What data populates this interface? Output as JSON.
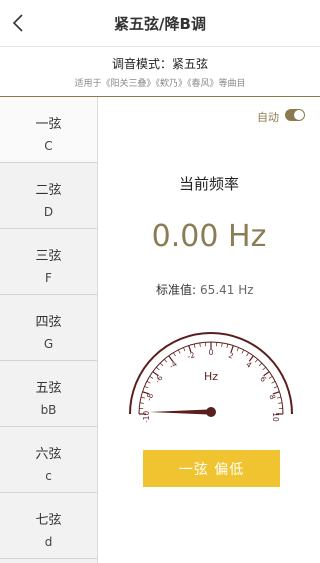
{
  "header": {
    "title": "紧五弦/降B调",
    "back_icon": "chevron-left-icon"
  },
  "mode": {
    "label": "调音模式：紧五弦",
    "songs": "适用于《阳关三叠》《欸乃》《春风》等曲目"
  },
  "strings": [
    {
      "name": "一弦",
      "note": "C"
    },
    {
      "name": "二弦",
      "note": "D"
    },
    {
      "name": "三弦",
      "note": "F"
    },
    {
      "name": "四弦",
      "note": "G"
    },
    {
      "name": "五弦",
      "note": "bB"
    },
    {
      "name": "六弦",
      "note": "c"
    },
    {
      "name": "七弦",
      "note": "d"
    }
  ],
  "auto": {
    "label": "自动",
    "on": true
  },
  "frequency": {
    "label": "当前频率",
    "value": "0.00 Hz"
  },
  "standard": {
    "label": "标准值:",
    "value": "65.41 Hz"
  },
  "gauge": {
    "unit": "Hz",
    "ticks": [
      "-10",
      "-8",
      "-6",
      "-4",
      "-2",
      "0",
      "2",
      "4",
      "6",
      "8",
      "10"
    ],
    "needle_value": -10
  },
  "status": {
    "label": "一弦  偏低"
  },
  "colors": {
    "accent": "#8c7a4e",
    "button": "#f0c330",
    "gauge": "#5a1e1e"
  }
}
